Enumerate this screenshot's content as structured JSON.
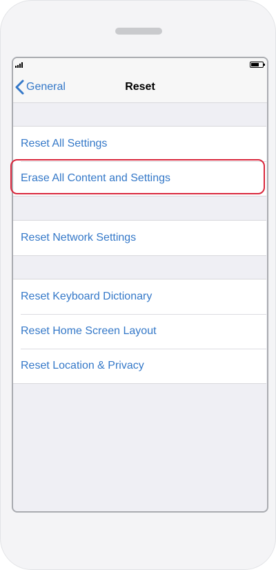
{
  "nav": {
    "back_label": "General",
    "title": "Reset"
  },
  "groups": [
    {
      "items": [
        {
          "label": "Reset All Settings"
        },
        {
          "label": "Erase All Content and Settings",
          "highlighted": true
        }
      ]
    },
    {
      "items": [
        {
          "label": "Reset Network Settings"
        }
      ]
    },
    {
      "items": [
        {
          "label": "Reset Keyboard Dictionary"
        },
        {
          "label": "Reset Home Screen Layout"
        },
        {
          "label": "Reset Location & Privacy"
        }
      ]
    }
  ],
  "colors": {
    "accent": "#3478c8",
    "highlight_border": "#d9273c",
    "grouped_background": "#efeff4"
  },
  "icons": {
    "back": "chevron-left-icon",
    "signal": "cellular-signal-icon",
    "battery": "battery-icon"
  }
}
